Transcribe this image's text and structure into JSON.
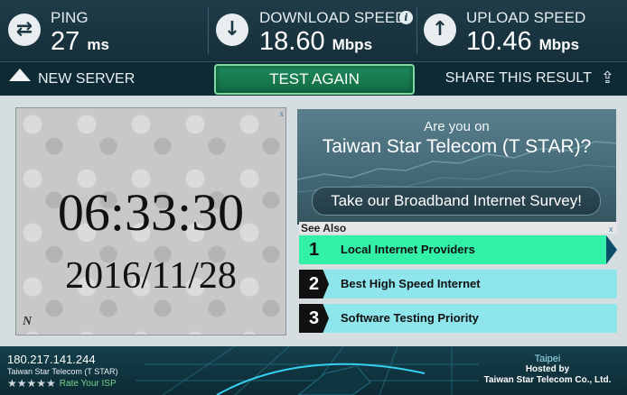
{
  "stats": {
    "ping": {
      "label": "PING",
      "value": "27",
      "unit": "ms"
    },
    "download": {
      "label": "DOWNLOAD SPEED",
      "value": "18.60",
      "unit": "Mbps",
      "info": "i"
    },
    "upload": {
      "label": "UPLOAD SPEED",
      "value": "10.46",
      "unit": "Mbps"
    }
  },
  "actions": {
    "new_server": "NEW SERVER",
    "test_again": "TEST AGAIN",
    "share": "SHARE THIS RESULT"
  },
  "clock_ad": {
    "time": "06:33:30",
    "date": "2016/11/28",
    "mark": "N",
    "ad_mark": "x"
  },
  "survey": {
    "question_line1": "Are you on",
    "question_line2": "Taiwan Star Telecom (T STAR)?",
    "cta": "Take our Broadband Internet Survey!"
  },
  "see_also": {
    "heading": "See Also",
    "ad_mark": "x",
    "links": [
      {
        "num": "1",
        "text": "Local Internet Providers",
        "color": "#33f0a8"
      },
      {
        "num": "2",
        "text": "Best High Speed Internet",
        "color": "#8ee6ec"
      },
      {
        "num": "3",
        "text": "Software Testing Priority",
        "color": "#8ee6ec"
      }
    ]
  },
  "client": {
    "ip": "180.217.141.244",
    "isp": "Taiwan Star Telecom (T STAR)",
    "stars": "★★★★★",
    "rate_label": "Rate Your ISP"
  },
  "host": {
    "city": "Taipei",
    "hosted_by": "Hosted by",
    "company": "Taiwan Star Telecom Co., Ltd."
  },
  "colors": {
    "accent_green": "#1f8a5b",
    "link_active": "#33f0a8",
    "link": "#8ee6ec",
    "bar_bg": "#1a3540"
  },
  "icons": [
    "ping-icon",
    "download-arrow-icon",
    "info-icon",
    "upload-arrow-icon",
    "new-server-triangle-icon",
    "share-icon",
    "star-icon"
  ]
}
